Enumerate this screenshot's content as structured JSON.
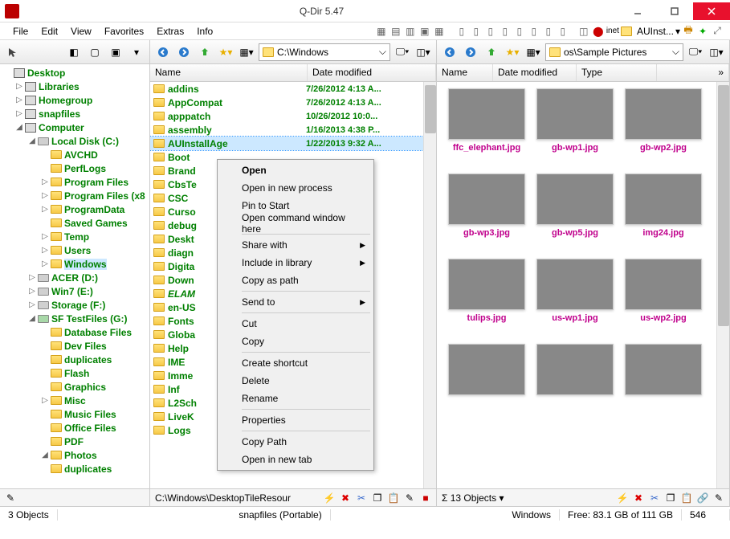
{
  "window": {
    "title": "Q-Dir 5.47"
  },
  "menu": {
    "file": "File",
    "edit": "Edit",
    "view": "View",
    "favorites": "Favorites",
    "extras": "Extras",
    "info": "Info",
    "auinst": "AUInst..."
  },
  "pane2": {
    "path": "C:\\Windows",
    "col_name": "Name",
    "col_date": "Date modified",
    "rows": [
      {
        "name": "addins",
        "date": "7/26/2012 4:13 A..."
      },
      {
        "name": "AppCompat",
        "date": "7/26/2012 4:13 A..."
      },
      {
        "name": "apppatch",
        "date": "10/26/2012 10:0..."
      },
      {
        "name": "assembly",
        "date": "1/16/2013 4:38 P..."
      },
      {
        "name": "AUInstallAge",
        "date": "1/22/2013 9:32 A...",
        "sel": true
      },
      {
        "name": "Boot",
        "date": ""
      },
      {
        "name": "Brand",
        "date": ""
      },
      {
        "name": "CbsTe",
        "date": ""
      },
      {
        "name": "CSC",
        "date": ""
      },
      {
        "name": "Curso",
        "date": ""
      },
      {
        "name": "debug",
        "date": ""
      },
      {
        "name": "Deskt",
        "date": ""
      },
      {
        "name": "diagn",
        "date": ""
      },
      {
        "name": "Digita",
        "date": ""
      },
      {
        "name": "Down",
        "date": ""
      },
      {
        "name": "ELAM",
        "date": "",
        "italic": true
      },
      {
        "name": "en-US",
        "date": ""
      },
      {
        "name": "Fonts",
        "date": ""
      },
      {
        "name": "Globa",
        "date": ""
      },
      {
        "name": "Help",
        "date": ""
      },
      {
        "name": "IME",
        "date": ""
      },
      {
        "name": "Imme",
        "date": ""
      },
      {
        "name": "Inf",
        "date": ""
      },
      {
        "name": "L2Sch",
        "date": ""
      },
      {
        "name": "LiveK",
        "date": ""
      },
      {
        "name": "Logs",
        "date": ""
      }
    ],
    "status_path": "C:\\Windows\\DesktopTileResour"
  },
  "pane3": {
    "path": "os\\Sample Pictures",
    "col_name": "Name",
    "col_date": "Date modified",
    "col_type": "Type",
    "thumbs": [
      {
        "cap": "ffc_elephant.jpg",
        "cls": "g1"
      },
      {
        "cap": "gb-wp1.jpg",
        "cls": "g2"
      },
      {
        "cap": "gb-wp2.jpg",
        "cls": "g3"
      },
      {
        "cap": "gb-wp3.jpg",
        "cls": "g4"
      },
      {
        "cap": "gb-wp5.jpg",
        "cls": "g5"
      },
      {
        "cap": "img24.jpg",
        "cls": "g6"
      },
      {
        "cap": "tulips.jpg",
        "cls": "g7"
      },
      {
        "cap": "us-wp1.jpg",
        "cls": "g8"
      },
      {
        "cap": "us-wp2.jpg",
        "cls": "g9"
      },
      {
        "cap": "",
        "cls": "g10"
      },
      {
        "cap": "",
        "cls": "g11"
      },
      {
        "cap": "",
        "cls": "g12"
      }
    ],
    "status": "Σ  13 Objects  ▾"
  },
  "tree": [
    {
      "txt": "Desktop",
      "ind": 0,
      "cls": "comp",
      "exp": ""
    },
    {
      "txt": "Libraries",
      "ind": 1,
      "cls": "comp",
      "exp": "▷"
    },
    {
      "txt": "Homegroup",
      "ind": 1,
      "cls": "comp",
      "exp": "▷"
    },
    {
      "txt": "snapfiles",
      "ind": 1,
      "cls": "comp",
      "exp": "▷"
    },
    {
      "txt": "Computer",
      "ind": 1,
      "cls": "comp",
      "exp": "◢"
    },
    {
      "txt": "Local Disk (C:)",
      "ind": 2,
      "cls": "drive",
      "exp": "◢"
    },
    {
      "txt": "AVCHD",
      "ind": 3,
      "cls": "folder",
      "exp": ""
    },
    {
      "txt": "PerfLogs",
      "ind": 3,
      "cls": "folder",
      "exp": ""
    },
    {
      "txt": "Program Files",
      "ind": 3,
      "cls": "folder",
      "exp": "▷"
    },
    {
      "txt": "Program Files (x8",
      "ind": 3,
      "cls": "folder",
      "exp": "▷"
    },
    {
      "txt": "ProgramData",
      "ind": 3,
      "cls": "folder",
      "exp": "▷"
    },
    {
      "txt": "Saved Games",
      "ind": 3,
      "cls": "folder",
      "exp": ""
    },
    {
      "txt": "Temp",
      "ind": 3,
      "cls": "folder",
      "exp": "▷"
    },
    {
      "txt": "Users",
      "ind": 3,
      "cls": "folder",
      "exp": "▷"
    },
    {
      "txt": "Windows",
      "ind": 3,
      "cls": "folder",
      "exp": "▷",
      "sel": true
    },
    {
      "txt": "ACER (D:)",
      "ind": 2,
      "cls": "drive",
      "exp": "▷"
    },
    {
      "txt": "Win7 (E:)",
      "ind": 2,
      "cls": "drive",
      "exp": "▷"
    },
    {
      "txt": "Storage (F:)",
      "ind": 2,
      "cls": "drive",
      "exp": "▷"
    },
    {
      "txt": "SF TestFiles (G:)",
      "ind": 2,
      "cls": "usb",
      "exp": "◢"
    },
    {
      "txt": "Database Files",
      "ind": 3,
      "cls": "folder",
      "exp": ""
    },
    {
      "txt": "Dev Files",
      "ind": 3,
      "cls": "folder",
      "exp": ""
    },
    {
      "txt": "duplicates",
      "ind": 3,
      "cls": "folder",
      "exp": ""
    },
    {
      "txt": "Flash",
      "ind": 3,
      "cls": "folder",
      "exp": ""
    },
    {
      "txt": "Graphics",
      "ind": 3,
      "cls": "folder",
      "exp": ""
    },
    {
      "txt": "Misc",
      "ind": 3,
      "cls": "folder",
      "exp": "▷"
    },
    {
      "txt": "Music Files",
      "ind": 3,
      "cls": "folder",
      "exp": ""
    },
    {
      "txt": "Office Files",
      "ind": 3,
      "cls": "folder",
      "exp": ""
    },
    {
      "txt": "PDF",
      "ind": 3,
      "cls": "folder",
      "exp": ""
    },
    {
      "txt": "Photos",
      "ind": 3,
      "cls": "folder",
      "exp": "◢"
    },
    {
      "txt": "duplicates",
      "ind": 3,
      "cls": "folder",
      "exp": ""
    }
  ],
  "ctx": {
    "open": "Open",
    "openproc": "Open in new process",
    "pin": "Pin to Start",
    "cmd": "Open command window here",
    "share": "Share with",
    "lib": "Include in library",
    "copypath": "Copy as path",
    "sendto": "Send to",
    "cut": "Cut",
    "copy": "Copy",
    "shortcut": "Create shortcut",
    "delete": "Delete",
    "rename": "Rename",
    "props": "Properties",
    "cpath": "Copy Path",
    "newtab": "Open in new tab"
  },
  "status": {
    "objects": "3 Objects",
    "app": "snapfiles (Portable)",
    "loc": "Windows",
    "free": "Free: 83.1 GB of 111 GB",
    "count": "546"
  }
}
